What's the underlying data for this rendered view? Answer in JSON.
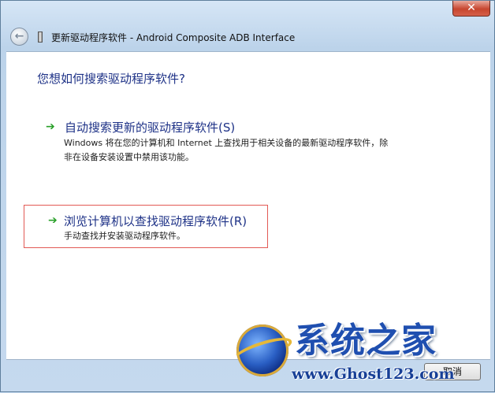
{
  "window": {
    "close_glyph": "✕",
    "title": "更新驱动程序软件 - Android Composite ADB Interface",
    "back_icon": "back-arrow-icon",
    "device_icon": "usb-device-icon"
  },
  "main": {
    "question": "您想如何搜索驱动程序软件?",
    "options": [
      {
        "icon": "green-arrow-icon",
        "title": "自动搜索更新的驱动程序软件(S)",
        "description": "Windows 将在您的计算机和 Internet 上查找用于相关设备的最新驱动程序软件，除非在设备安装设置中禁用该功能。"
      },
      {
        "icon": "green-arrow-icon",
        "title": "浏览计算机以查找驱动程序软件(R)",
        "description": "手动查找并安装驱动程序软件。",
        "highlight_color": "#e25a55"
      }
    ]
  },
  "footer": {
    "cancel_label": "取消"
  },
  "watermark": {
    "title": "系统之家",
    "url": "www.Ghost123.com"
  },
  "colors": {
    "link_blue": "#1e3287",
    "arrow_green": "#2aa02a",
    "close_red": "#c7462f"
  }
}
